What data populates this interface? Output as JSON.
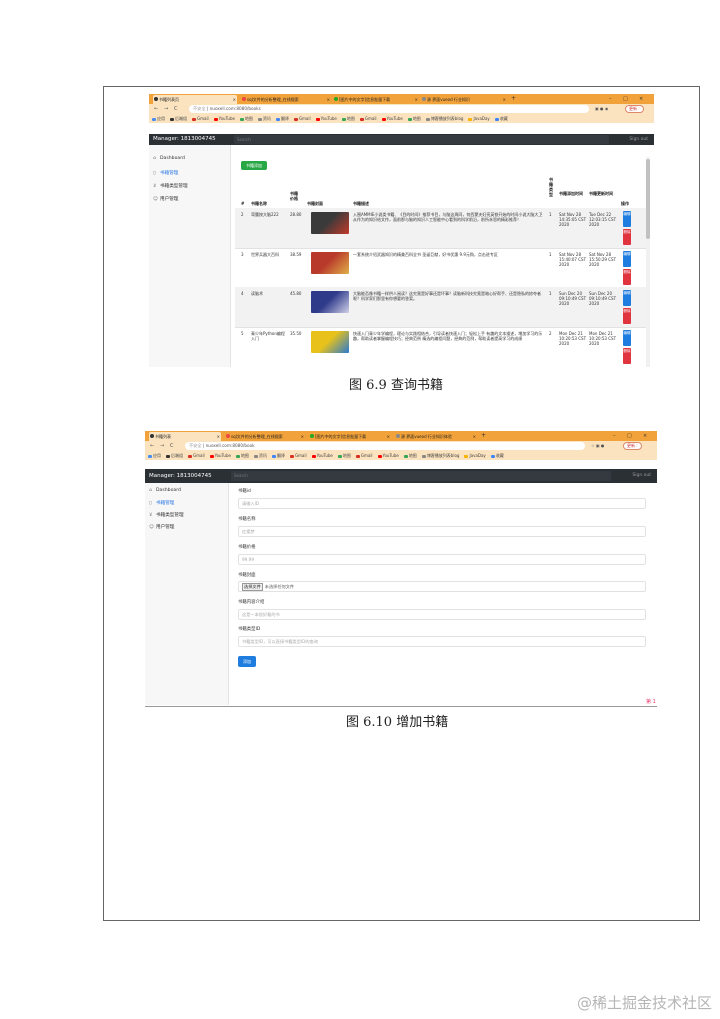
{
  "browser1": {
    "tabs": [
      {
        "label": "书籍列表页",
        "active": true
      },
      {
        "label": "sql文件的分析整理_在线搜索"
      },
      {
        "label": "[图片中的文字]信息批量下载"
      },
      {
        "label": "源 界面vueod 行业知识"
      }
    ],
    "url_insecure": "不安全",
    "url": "nuoxell.com:8080/books",
    "update_label": "更新 :"
  },
  "browser2": {
    "tabs": [
      {
        "label": "书籍列表",
        "active": true
      },
      {
        "label": "sql文件的分析整理_在线搜索"
      },
      {
        "label": "[图片中的文字]信息批量下载"
      },
      {
        "label": "源 界面vueod 行业知识体验"
      }
    ],
    "url_insecure": "不安全",
    "url": "nuoxell.com:8080/book",
    "update_label": "更新 :"
  },
  "bookmarks": [
    {
      "label": "应用",
      "color": "#4a8ef0"
    },
    {
      "label": "后端组",
      "color": "#333333"
    },
    {
      "label": "Gmail",
      "color": "#d93025"
    },
    {
      "label": "YouTube",
      "color": "#ff0000"
    },
    {
      "label": "地图",
      "color": "#34a853"
    },
    {
      "label": "资讯",
      "color": "#888888"
    },
    {
      "label": "翻译",
      "color": "#4285f4"
    },
    {
      "label": "Gmail",
      "color": "#d93025"
    },
    {
      "label": "YouTube",
      "color": "#ff0000"
    },
    {
      "label": "地图",
      "color": "#34a853"
    },
    {
      "label": "Gmail",
      "color": "#d93025"
    },
    {
      "label": "YouTube",
      "color": "#ff0000"
    },
    {
      "label": "地图",
      "color": "#34a853"
    },
    {
      "label": "博客播放列表blog",
      "color": "#888888"
    },
    {
      "label": "JavaDay",
      "color": "#f4b400"
    },
    {
      "label": "收藏",
      "color": "#4285f4"
    }
  ],
  "app": {
    "brand": "Manager:  1813004745",
    "search_placeholder": "Search",
    "signout": "Sign out",
    "sidebar": [
      {
        "label": "Dashboard",
        "icon": "home-icon"
      },
      {
        "label": "书籍管理",
        "icon": "file-icon",
        "active": true
      },
      {
        "label": "书籍类型管理",
        "icon": "cart-icon"
      },
      {
        "label": "用户管理",
        "icon": "users-icon"
      }
    ]
  },
  "books_list": {
    "add_button": "书籍添加",
    "headers": {
      "index": "#",
      "name": "书籍名称",
      "price": "书籍价格",
      "cover": "书籍封面",
      "desc": "书籍描述",
      "type": "书籍类型",
      "created": "书籍添加时间",
      "updated": "书籍更新时间",
      "ops": "操作"
    },
    "rows": [
      {
        "index": "2",
        "name": "弯腰按大脑222",
        "price": "28.80",
        "desc": "入围AMMIE小说类书籍、《目的时间》推荐书目，与脑这周同，何西蒙夫妇亮英铁开始的时间小说大脑大卫 从作为的知识给文作，面前那与脑的知识人工智能中心看到的科学前沿，前所未思的精彩推荐！",
        "type": "1",
        "created": "Sat Nov 28 14:35:05 CST 2020",
        "updated": "Tue Dec 22 12:03:15 CST 2020",
        "cover_colors": [
          "#3a3a3a",
          "#c23a2a"
        ]
      },
      {
        "index": "3",
        "name": "世界兵器大百科",
        "price": "38.59",
        "desc": "一套系统介绍武器知识的精美百科全书 圣诞巨献，好书优惠 9.9元购，点击进专区",
        "type": "1",
        "created": "Sat Nov 28 15:40:07 CST 2020",
        "updated": "Sat Nov 28 15:50:29 CST 2020",
        "cover_colors": [
          "#b83a2a",
          "#e2b04a"
        ]
      },
      {
        "index": "4",
        "name": "读脑术",
        "price": "45.80",
        "desc": "大脑能否像书籍一样供人阅读？这究竟是好事还是坏事？读脑新科技究竟是暗心好帮手、还是隐私的掠夺者呢？科学家们那里有你想要的答案。",
        "type": "1",
        "created": "Sun Dec 20 09:10:49 CST 2020",
        "updated": "Sun Dec 20 09:10:49 CST 2020",
        "cover_colors": [
          "#2e3a8a",
          "#d0d0e8"
        ]
      },
      {
        "index": "5",
        "name": "青少年Python编程入门",
        "price": "35.50",
        "desc": "快速入门青少年学编程，理论与实践相结合，引导读者快速入门；轻松上手 有趣的文本描述，增加学习的乐趣，帮助读者掌握编程技巧；经典范例 精选的编程问题，经典的范例，帮助读者提高学习的成绩",
        "type": "2",
        "created": "Mon Dec 21 10:20:53 CST 2020",
        "updated": "Mon Dec 21 10:20:53 CST 2020",
        "cover_colors": [
          "#e8c21a",
          "#2a7ad0"
        ]
      }
    ],
    "edit_label": "编辑",
    "delete_label": "删除"
  },
  "caption1": "图 6.9 查询书籍",
  "book_form": {
    "fields": [
      {
        "label": "书籍id",
        "placeholder": "请输入ID"
      },
      {
        "label": "书籍名称",
        "placeholder": "红楼梦"
      },
      {
        "label": "书籍价格",
        "placeholder": "99.99"
      },
      {
        "label": "书籍封面",
        "type": "file"
      },
      {
        "label": "书籍内容介绍",
        "placeholder": "这是一本很好看的书"
      },
      {
        "label": "书籍类型ID",
        "placeholder": "书籍类型ID，可以直接书籍类型ID的查询"
      }
    ],
    "file_button": "选择文件",
    "file_text": "未选择任何文件",
    "submit": "添加"
  },
  "page_number": "第 1",
  "caption2": "图 6.10 增加书籍",
  "watermark": "@稀土掘金技术社区"
}
